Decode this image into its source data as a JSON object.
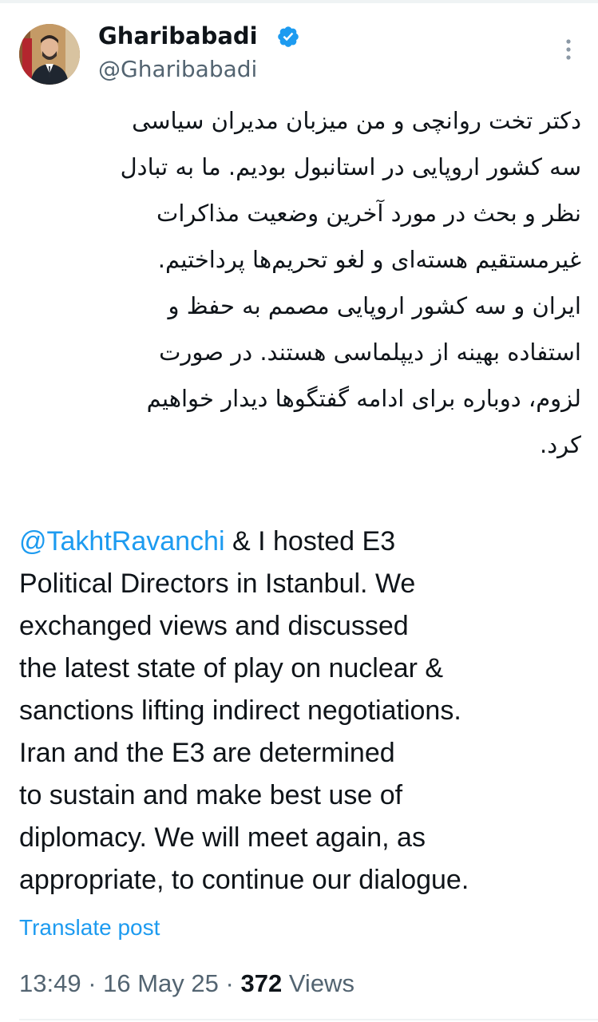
{
  "author": {
    "display_name": "Gharibabadi",
    "handle": "@Gharibabadi",
    "verified_icon": "verified-badge-icon",
    "avatar_icon": "profile-photo"
  },
  "menu": {
    "more_icon": "more-vertical-icon"
  },
  "post": {
    "persian_lines": [
      "دکتر تخت روانچی و من میزبان مدیران سیاسی",
      "سه کشور اروپایی در استانبول بودیم. ما به تبادل",
      "نظر و بحث در مورد آخرین وضعیت مذاکرات",
      "غیرمستقیم هسته‌ای و لغو تحریم‌ها پرداختیم.",
      "ایران و سه کشور اروپایی مصمم به حفظ و",
      "استفاده بهینه از دیپلماسی هستند. در صورت",
      "لزوم، دوباره برای ادامه گفتگوها دیدار خواهیم",
      "کرد."
    ],
    "english": {
      "mention": "@TakhtRavanchi",
      "first_line_rest": " & I hosted E3",
      "lines": [
        "Political Directors in Istanbul. We",
        "exchanged views and discussed",
        "the latest state of play on nuclear &",
        "sanctions lifting indirect negotiations.",
        "Iran and the E3 are determined",
        "to sustain and make best use of",
        "diplomacy. We will meet again, as",
        "appropriate, to continue our dialogue."
      ]
    },
    "translate_label": "Translate post"
  },
  "meta": {
    "time": "13:49",
    "separator": " · ",
    "date": "16 May 25",
    "views_count": "372",
    "views_label": " Views"
  },
  "colors": {
    "link": "#1d9bf0",
    "verified": "#1d9bf0",
    "text": "#0f1419",
    "secondary": "#536471"
  }
}
